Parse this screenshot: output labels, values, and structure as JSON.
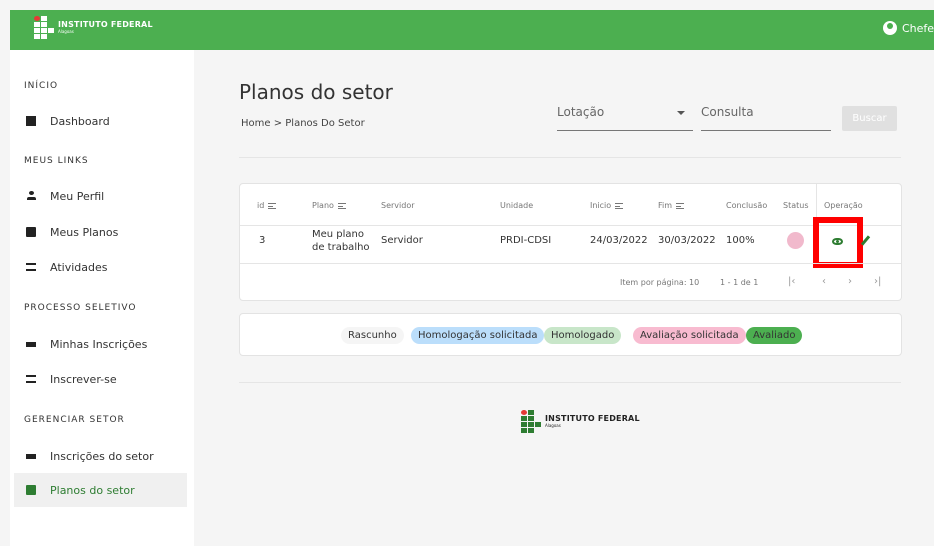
{
  "brand": {
    "name": "INSTITUTO FEDERAL",
    "sub": "Alagoas"
  },
  "user": {
    "name": "Chefe"
  },
  "sidebar": {
    "sections": [
      "INÍCIO",
      "MEUS LINKS",
      "PROCESSO SELETIVO",
      "GERENCIAR SETOR"
    ],
    "items": [
      {
        "label": "Dashboard",
        "icon": "dashboard-icon"
      },
      {
        "label": "Meu Perfil",
        "icon": "person-icon"
      },
      {
        "label": "Meus Planos",
        "icon": "book-icon"
      },
      {
        "label": "Atividades",
        "icon": "list-icon"
      },
      {
        "label": "Minhas Inscrições",
        "icon": "bar-icon"
      },
      {
        "label": "Inscrever-se",
        "icon": "list-add-icon"
      },
      {
        "label": "Inscrições do setor",
        "icon": "bar-icon"
      },
      {
        "label": "Planos do setor",
        "icon": "clipboard-icon",
        "active": true
      }
    ]
  },
  "page": {
    "title": "Planos do setor",
    "breadcrumb": "Home > Planos Do Setor"
  },
  "filters": {
    "lotacao": "Lotação",
    "consulta": "Consulta",
    "search_button": "Buscar"
  },
  "table": {
    "headers": [
      "id",
      "Plano",
      "Servidor",
      "Unidade",
      "Inicio",
      "Fim",
      "Conclusão",
      "Status",
      "Operação"
    ],
    "rows": [
      {
        "id": "3",
        "plano_1": "Meu plano",
        "plano_2": "de trabalho",
        "servidor": "Servidor",
        "unidade": "PRDI-CDSI",
        "inicio": "24/03/2022",
        "fim": "30/03/2022",
        "conclusao": "100%"
      }
    ],
    "pagination": {
      "per_page": "Item por página: 10",
      "range": "1 - 1 de 1"
    }
  },
  "legend": [
    "Rascunho",
    "Homologação solicitada",
    "Homologado",
    "Avaliação solicitada",
    "Avaliado"
  ],
  "colors": {
    "primary": "#4caf50",
    "highlight": "#ff0000"
  }
}
